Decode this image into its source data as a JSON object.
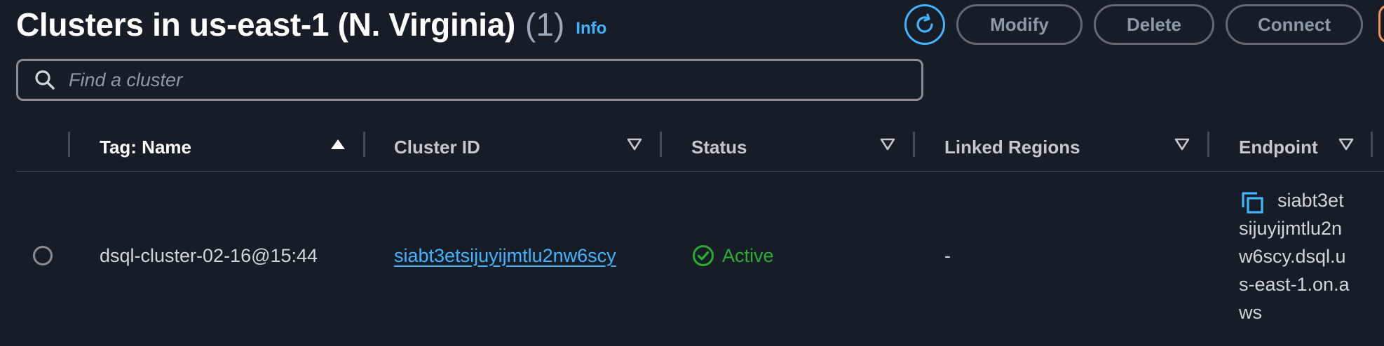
{
  "header": {
    "title": "Clusters in us-east-1 (N. Virginia)",
    "count": "(1)",
    "info_link": "Info"
  },
  "actions": {
    "refresh_icon": "refresh-icon",
    "modify": "Modify",
    "delete": "Delete",
    "connect": "Connect"
  },
  "search": {
    "placeholder": "Find a cluster",
    "value": "",
    "icon": "search-icon"
  },
  "table": {
    "columns": [
      {
        "label": "Tag: Name",
        "sort": "ascending"
      },
      {
        "label": "Cluster ID",
        "sort": "none"
      },
      {
        "label": "Status",
        "sort": "none"
      },
      {
        "label": "Linked Regions",
        "sort": "none"
      },
      {
        "label": "Endpoint",
        "sort": "none"
      }
    ],
    "rows": [
      {
        "selected": false,
        "name": "dsql-cluster-02-16@15:44",
        "cluster_id": "siabt3etsijuyijmtlu2nw6scy",
        "status": "Active",
        "status_icon": "check-circle-icon",
        "linked_regions": "-",
        "endpoint": "siabt3etsijuyijmtlu2nw6scy.dsql.us-east-1.on.aws",
        "endpoint_icon": "copy-icon"
      }
    ]
  },
  "colors": {
    "background": "#161d26",
    "accent": "#42b4ff",
    "success": "#29ad32",
    "border": "#8c8c94"
  }
}
